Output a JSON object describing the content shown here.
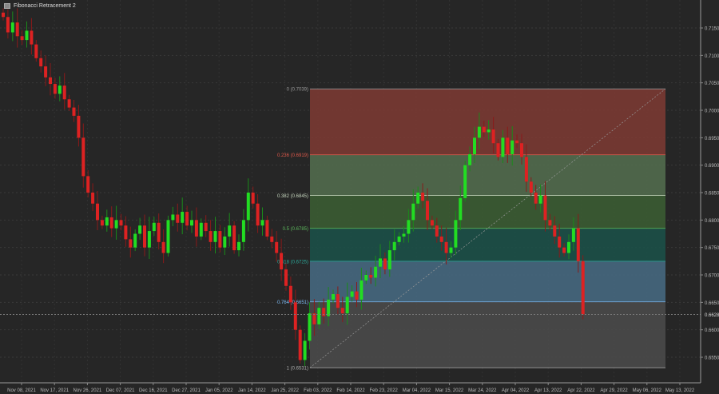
{
  "title": "Fibonacci Retracement 2",
  "colors": {
    "background": "#262626",
    "up": "#22dd22",
    "down": "#dd2222",
    "grid": "#3a3a3a"
  },
  "chart_data": {
    "type": "candlestick",
    "symbol_title": "Fibonacci Retracement 2",
    "ylim": [
      0.6515,
      0.7185
    ],
    "y_ticks": [
      "0.7150",
      "0.7100",
      "0.7050",
      "0.7000",
      "0.6950",
      "0.6900",
      "0.6850",
      "0.6800",
      "0.6750",
      "0.6700",
      "0.6650",
      "0.6600",
      "0.6550"
    ],
    "y_tick_values": [
      0.715,
      0.71,
      0.705,
      0.7,
      0.695,
      0.69,
      0.685,
      0.68,
      0.675,
      0.67,
      0.665,
      0.66,
      0.655
    ],
    "current_price": "0.6628",
    "current_price_value": 0.6628,
    "x_ticks": [
      "Nov 08, 2021",
      "Nov 17, 2021",
      "Nov 26, 2021",
      "Dec 07, 2021",
      "Dec 16, 2021",
      "Dec 27, 2021",
      "Jan 05, 2022",
      "Jan 14, 2022",
      "Jan 25, 2022",
      "Feb 03, 2022",
      "Feb 14, 2022",
      "Feb 23, 2022",
      "Mar 04, 2022",
      "Mar 15, 2022",
      "Mar 24, 2022",
      "Apr 04, 2022",
      "Apr 13, 2022",
      "Apr 22, 2022",
      "Apr 29, 2022",
      "May 06, 2022",
      "May 13, 2022"
    ],
    "closes": [
      0.717,
      0.7142,
      0.716,
      0.7135,
      0.7128,
      0.7145,
      0.712,
      0.7095,
      0.708,
      0.706,
      0.7048,
      0.703,
      0.7045,
      0.702,
      0.7005,
      0.699,
      0.695,
      0.688,
      0.685,
      0.683,
      0.68,
      0.679,
      0.6805,
      0.6785,
      0.68,
      0.679,
      0.6765,
      0.675,
      0.6775,
      0.679,
      0.675,
      0.678,
      0.6795,
      0.676,
      0.674,
      0.68,
      0.681,
      0.6795,
      0.6815,
      0.679,
      0.68,
      0.677,
      0.6795,
      0.678,
      0.676,
      0.678,
      0.675,
      0.677,
      0.679,
      0.6745,
      0.676,
      0.68,
      0.685,
      0.683,
      0.679,
      0.68,
      0.677,
      0.676,
      0.674,
      0.671,
      0.668,
      0.665,
      0.66,
      0.6545,
      0.658,
      0.663,
      0.661,
      0.664,
      0.6625,
      0.6655,
      0.6665,
      0.664,
      0.663,
      0.666,
      0.667,
      0.6655,
      0.669,
      0.67,
      0.6695,
      0.6715,
      0.673,
      0.671,
      0.6745,
      0.676,
      0.677,
      0.6775,
      0.68,
      0.683,
      0.685,
      0.6835,
      0.68,
      0.679,
      0.677,
      0.676,
      0.674,
      0.675,
      0.68,
      0.684,
      0.69,
      0.692,
      0.695,
      0.697,
      0.696,
      0.6965,
      0.694,
      0.6915,
      0.695,
      0.692,
      0.6945,
      0.694,
      0.6915,
      0.687,
      0.685,
      0.683,
      0.6845,
      0.68,
      0.679,
      0.677,
      0.675,
      0.674,
      0.676,
      0.6785,
      0.6725,
      0.6628
    ],
    "fibonacci": {
      "levels": [
        {
          "label": "0 (0.7039)",
          "ratio": 0,
          "price": 0.7039,
          "color": "#999999",
          "fill": "#7a3a33"
        },
        {
          "label": "0.236 (0.6919)",
          "ratio": 0.236,
          "price": 0.6919,
          "color": "#e0584a",
          "fill": "#526b4e"
        },
        {
          "label": "0.382 (0.6845)",
          "ratio": 0.382,
          "price": 0.6845,
          "color": "#c8d8c0",
          "fill": "#3b5c33"
        },
        {
          "label": "0.5 (0.6785)",
          "ratio": 0.5,
          "price": 0.6785,
          "color": "#5cb85c",
          "fill": "#1c5048"
        },
        {
          "label": "0.618 (0.6725)",
          "ratio": 0.618,
          "price": 0.6725,
          "color": "#2aa89a",
          "fill": "#46687f"
        },
        {
          "label": "0.764 (0.6651)",
          "ratio": 0.764,
          "price": 0.6651,
          "color": "#7ab8f0",
          "fill": "#4a4a4a"
        },
        {
          "label": "1 (0.6531)",
          "ratio": 1,
          "price": 0.6531,
          "color": "#aaaaaa",
          "fill": null
        }
      ]
    }
  }
}
